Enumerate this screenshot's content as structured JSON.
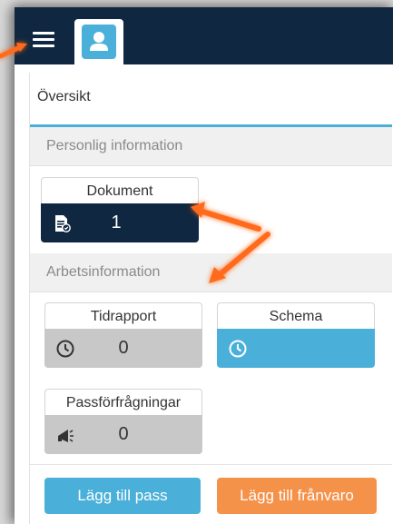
{
  "overview": {
    "title": "Översikt"
  },
  "sections": {
    "personal": "Personlig information",
    "work": "Arbetsinformation"
  },
  "tiles": {
    "dokument": {
      "label": "Dokument",
      "count": "1"
    },
    "tidrapport": {
      "label": "Tidrapport",
      "count": "0"
    },
    "schema": {
      "label": "Schema"
    },
    "passforfragningar": {
      "label": "Passförfrågningar",
      "count": "0"
    }
  },
  "buttons": {
    "add_shift": "Lägg till pass",
    "add_absence": "Lägg till frånvaro"
  },
  "colors": {
    "topbar": "#0f2740",
    "accent": "#4ab0d9",
    "dark_tile": "#0f2740",
    "grey_tile": "#c8c8c8",
    "orange": "#f5924a",
    "annotation_arrow": "#ff6a1a"
  },
  "icons": [
    "menu-icon",
    "user-icon",
    "document-check-icon",
    "clock-icon",
    "megaphone-icon"
  ]
}
